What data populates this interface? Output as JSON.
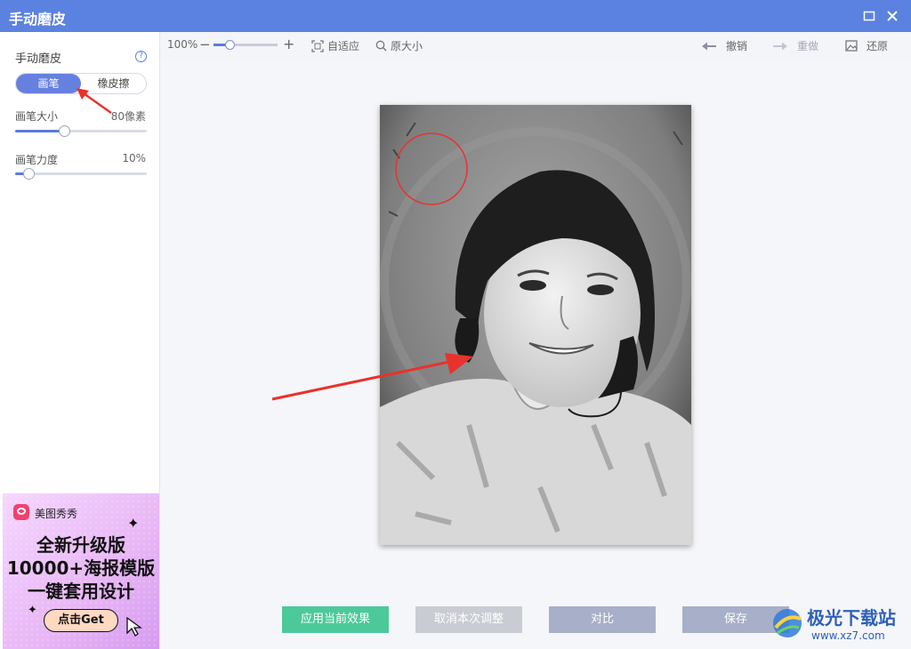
{
  "window": {
    "title": "手动磨皮"
  },
  "sidebar": {
    "title": "手动磨皮",
    "help_glyph": "?",
    "modes": [
      "画笔",
      "橡皮擦"
    ],
    "brush_size": {
      "label": "画笔大小",
      "value": "80像素",
      "fraction": 0.37
    },
    "brush_strength": {
      "label": "画笔力度",
      "value": "10%",
      "fraction": 0.1
    }
  },
  "ad": {
    "brand": "美图秀秀",
    "lines": [
      "全新升级版",
      "10000+海报模版",
      "一键套用设计"
    ],
    "cta": "点击Get"
  },
  "toolbar": {
    "zoom_value": "100%",
    "zoom_fraction": 0.25,
    "fit_label": "自适应",
    "original_size_label": "原大小",
    "undo_label": "撤销",
    "redo_label": "重做",
    "restore_label": "还原"
  },
  "actions": {
    "apply": "应用当前效果",
    "cancel": "取消本次调整",
    "compare": "对比",
    "save": "保存"
  },
  "watermark": {
    "name": "极光下载站",
    "url": "www.xz7.com"
  },
  "colors": {
    "titlebar": "#5b82e0",
    "accent": "#6680e0",
    "apply": "#4cc99a",
    "disabled": "#c9ccd3",
    "compare": "#a8afc8",
    "annotation_red": "#e8322c"
  }
}
